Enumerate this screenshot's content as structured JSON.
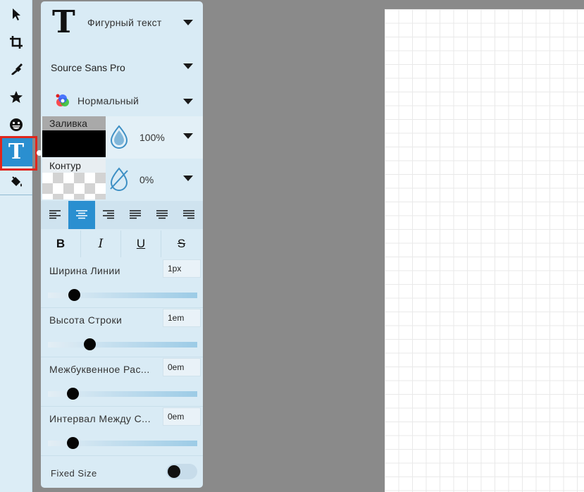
{
  "text_panel": {
    "style_select": "Фигурный текст",
    "font_select": "Source Sans Pro",
    "blend_select": "Нормальный",
    "fill": {
      "label": "Заливка",
      "color": "#000000",
      "opacity": "100%"
    },
    "stroke": {
      "label": "Контур",
      "color": "transparent",
      "opacity": "0%"
    },
    "align_buttons": [
      "align-left",
      "align-center",
      "align-right",
      "justify-left",
      "justify-center",
      "justify-right"
    ],
    "align_active": "align-center",
    "format_buttons": {
      "bold": "B",
      "italic": "I",
      "underline": "U",
      "strike": "S"
    },
    "props": [
      {
        "label": "Ширина Линии",
        "value": "1px",
        "slider": 0.15
      },
      {
        "label": "Высота Строки",
        "value": "1em",
        "slider": 0.26
      },
      {
        "label": "Межбуквенное Рас...",
        "value": "0em",
        "slider": 0.14
      },
      {
        "label": "Интервал Между С...",
        "value": "0em",
        "slider": 0.14
      }
    ],
    "fixed_size": {
      "label": "Fixed Size",
      "on": false
    }
  },
  "tools": [
    "select-arrow-icon",
    "crop-icon",
    "brush-icon",
    "star-icon",
    "emoji-icon",
    "text-icon",
    "fill-bucket-icon"
  ],
  "tool_active": "text-icon",
  "colors": {
    "accent": "#2a8fd0",
    "highlight": "#e0261c",
    "panel": "#d9ebf5",
    "workspace": "#8a8a8a"
  }
}
